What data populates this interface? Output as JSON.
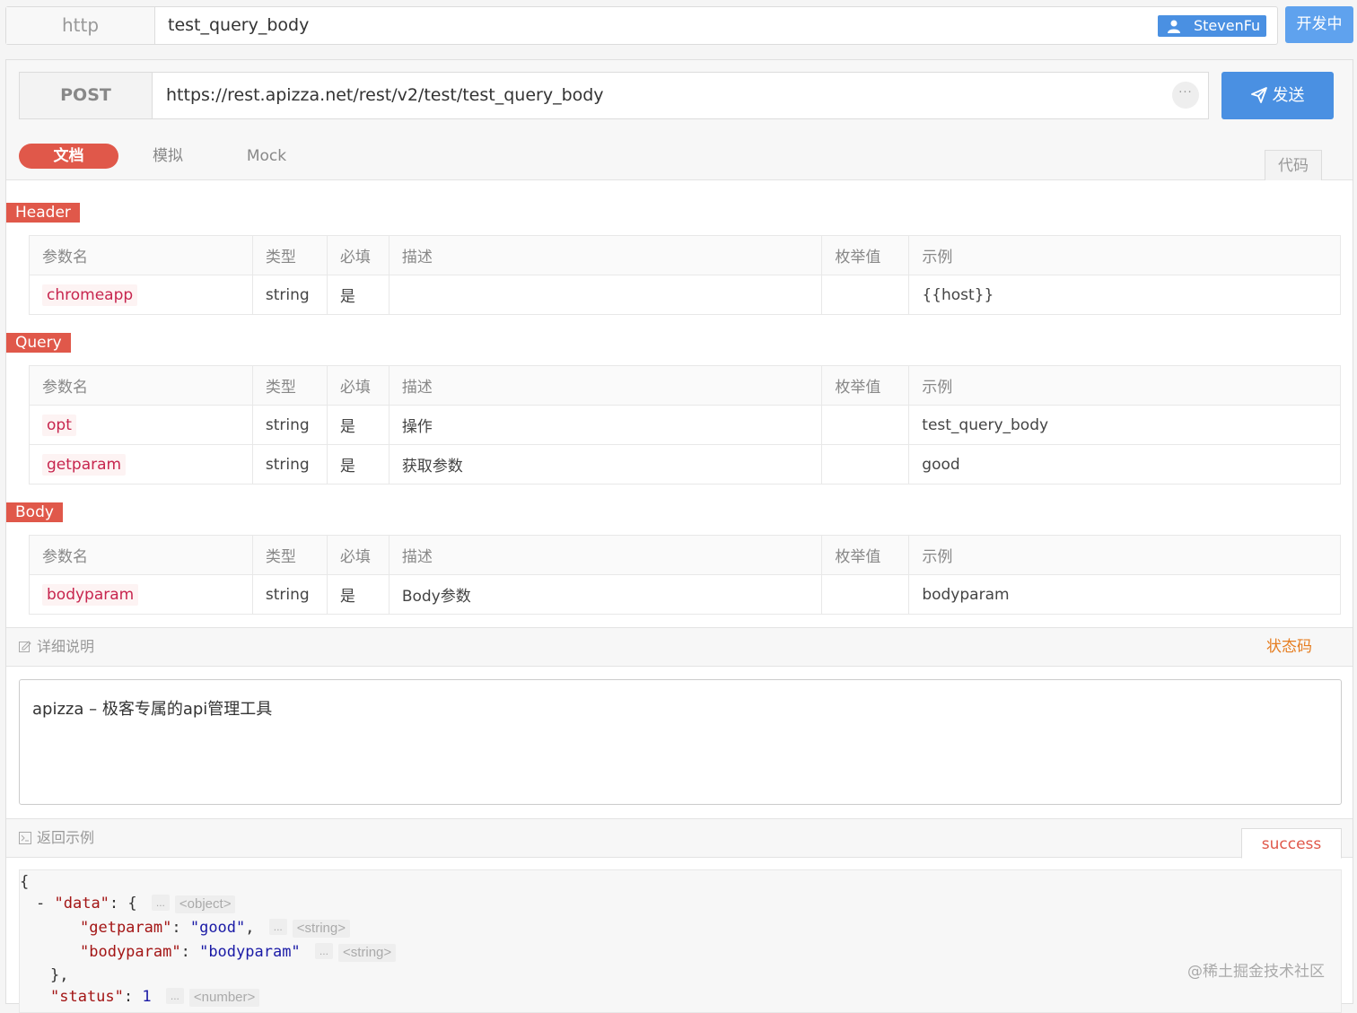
{
  "top_bar": {
    "protocol": "http",
    "api_name": "test_query_body",
    "user": "StevenFu",
    "status": "开发中"
  },
  "request": {
    "method": "POST",
    "url": "https://rest.apizza.net/rest/v2/test/test_query_body",
    "more": "···",
    "send_label": "发送"
  },
  "tabs": [
    {
      "label": "文档",
      "active": true
    },
    {
      "label": "模拟",
      "active": false
    },
    {
      "label": "Mock",
      "active": false
    }
  ],
  "code_button": "代码",
  "columns": [
    "参数名",
    "类型",
    "必填",
    "描述",
    "枚举值",
    "示例"
  ],
  "sections": {
    "header": {
      "label": "Header",
      "rows": [
        {
          "name": "chromeapp",
          "type": "string",
          "required": "是",
          "desc": "",
          "enum": "",
          "example": "{{host}}"
        }
      ]
    },
    "query": {
      "label": "Query",
      "rows": [
        {
          "name": "opt",
          "type": "string",
          "required": "是",
          "desc": "操作",
          "enum": "",
          "example": "test_query_body"
        },
        {
          "name": "getparam",
          "type": "string",
          "required": "是",
          "desc": "获取参数",
          "enum": "",
          "example": "good"
        }
      ]
    },
    "body": {
      "label": "Body",
      "rows": [
        {
          "name": "bodyparam",
          "type": "string",
          "required": "是",
          "desc": "Body参数",
          "enum": "",
          "example": "bodyparam"
        }
      ]
    }
  },
  "detail": {
    "label": "详细说明",
    "status_code_link": "状态码",
    "text": "apizza – 极客专属的api管理工具"
  },
  "return_example": {
    "label": "返回示例",
    "tab": "success",
    "lines": {
      "open_brace": "{",
      "data_key": "\"data\"",
      "data_open": ": {",
      "data_type": "<object>",
      "getparam_key": "\"getparam\"",
      "getparam_val": "\"good\"",
      "getparam_type": "<string>",
      "bodyparam_key": "\"bodyparam\"",
      "bodyparam_val": "\"bodyparam\"",
      "bodyparam_type": "<string>",
      "data_close": "},",
      "status_key": "\"status\"",
      "status_val": "1",
      "status_type": "<number>",
      "dots": "..."
    }
  },
  "watermark": "@稀土掘金技术社区"
}
